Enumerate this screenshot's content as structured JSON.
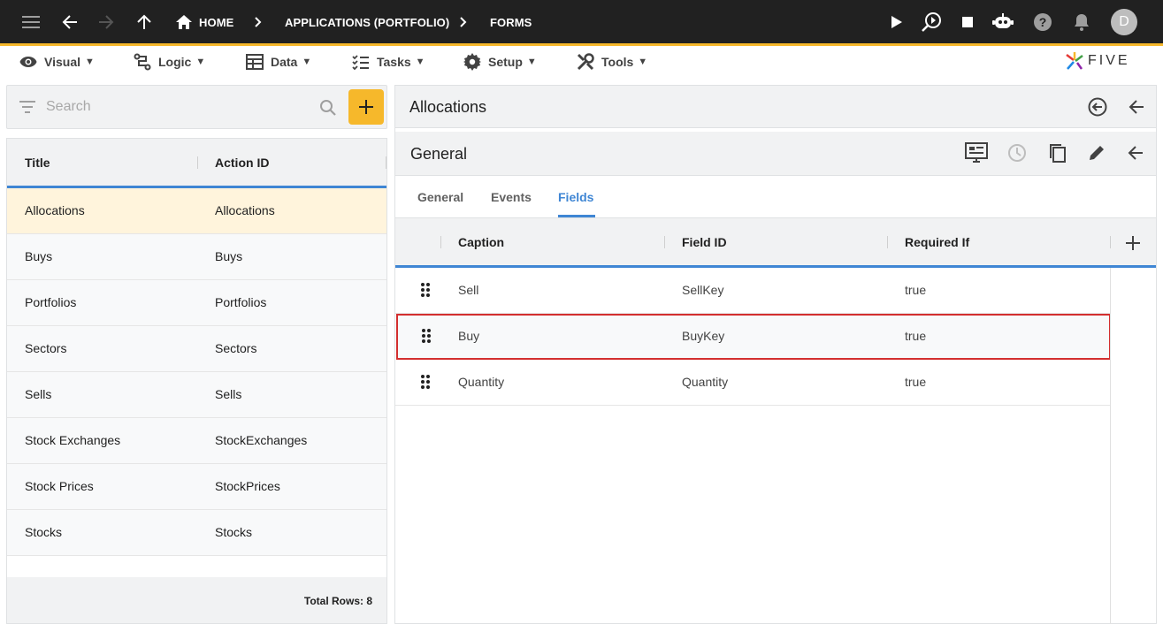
{
  "topbar": {
    "breadcrumbs": [
      "HOME",
      "APPLICATIONS (PORTFOLIO)",
      "FORMS"
    ],
    "avatar_initial": "D"
  },
  "menu": [
    {
      "label": "Visual"
    },
    {
      "label": "Logic"
    },
    {
      "label": "Data"
    },
    {
      "label": "Tasks"
    },
    {
      "label": "Setup"
    },
    {
      "label": "Tools"
    }
  ],
  "logo_text": "FIVE",
  "search": {
    "placeholder": "Search"
  },
  "list": {
    "headers": [
      "Title",
      "Action ID"
    ],
    "rows": [
      {
        "title": "Allocations",
        "action_id": "Allocations",
        "selected": true
      },
      {
        "title": "Buys",
        "action_id": "Buys"
      },
      {
        "title": "Portfolios",
        "action_id": "Portfolios"
      },
      {
        "title": "Sectors",
        "action_id": "Sectors"
      },
      {
        "title": "Sells",
        "action_id": "Sells"
      },
      {
        "title": "Stock Exchanges",
        "action_id": "StockExchanges"
      },
      {
        "title": "Stock Prices",
        "action_id": "StockPrices"
      },
      {
        "title": "Stocks",
        "action_id": "Stocks"
      }
    ],
    "total_label": "Total Rows: 8"
  },
  "detail": {
    "title": "Allocations",
    "section_title": "General",
    "tabs": [
      "General",
      "Events",
      "Fields"
    ],
    "active_tab": "Fields",
    "fields_headers": [
      "Caption",
      "Field ID",
      "Required If"
    ],
    "fields_rows": [
      {
        "caption": "Sell",
        "field_id": "SellKey",
        "required_if": "true"
      },
      {
        "caption": "Buy",
        "field_id": "BuyKey",
        "required_if": "true",
        "highlighted": true
      },
      {
        "caption": "Quantity",
        "field_id": "Quantity",
        "required_if": "true"
      }
    ]
  },
  "colors": {
    "accent": "#3f86d4",
    "brand_yellow": "#f6b82b",
    "highlight_border": "#d32f2f",
    "topbar": "#212121"
  }
}
